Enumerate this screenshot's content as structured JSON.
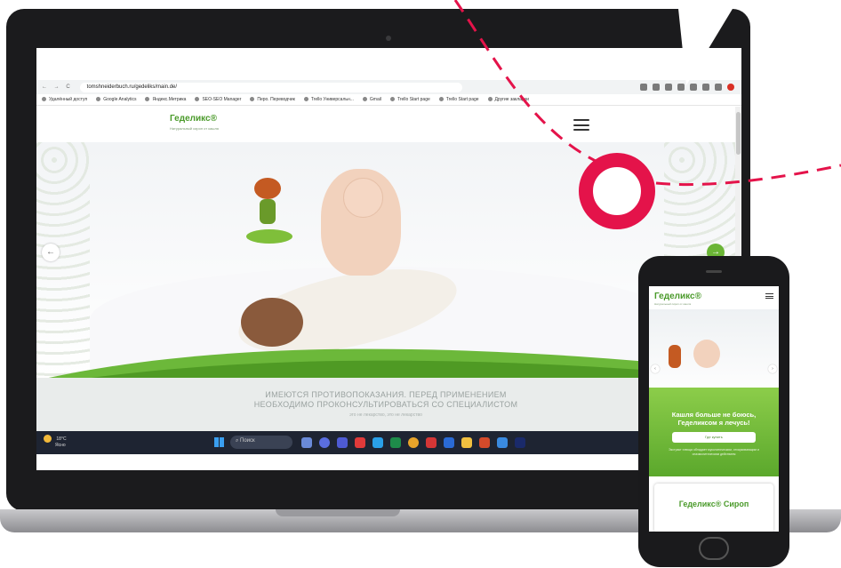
{
  "browser": {
    "url": "tomshneiderbuch.ru/gedeliks/main.de/",
    "nav_buttons": "← → C",
    "bookmarks": [
      "Удалённый доступ",
      "Google Analytics",
      "Яндекс.Метрика",
      "SEO-SEO Manager",
      "Перо. Переводчик",
      "Trello Универсальн...",
      "Gmail",
      "Trello Start page",
      "Trello Start page"
    ],
    "bookmarks_other": "Другие закладки"
  },
  "site": {
    "logo": "Геделикс®",
    "logo_sub": "Натуральный сироп от кашля",
    "warning_line1": "ИМЕЮТСЯ ПРОТИВОПОКАЗАНИЯ. ПЕРЕД ПРИМЕНЕНИЕМ",
    "warning_line2": "НЕОБХОДИМО ПРОКОНСУЛЬТИРОВАТЬСЯ СО СПЕЦИАЛИСТОМ",
    "warning_sub": "это не лекарство, это не лекарство",
    "arrow_left": "←",
    "arrow_right": "→"
  },
  "taskbar": {
    "temperature": "18°C",
    "weather": "Ясно",
    "search_label": "Поиск",
    "right_text": "Р"
  },
  "phone": {
    "logo": "Геделикс®",
    "logo_sub": "Натуральный сироп от кашля",
    "slogan": "Кашля больше не боюсь, Геделиксом я лечусь!",
    "button": "Где купить",
    "info": "Экстракт плюща обладает муколитическим, отхаркивающим и спазмолитическим действием",
    "card_title": "Геделикс® Сироп",
    "arrow_left": "‹",
    "arrow_right": "›"
  },
  "colors": {
    "accent_red": "#e4134a",
    "brand_green": "#5ba82c"
  }
}
